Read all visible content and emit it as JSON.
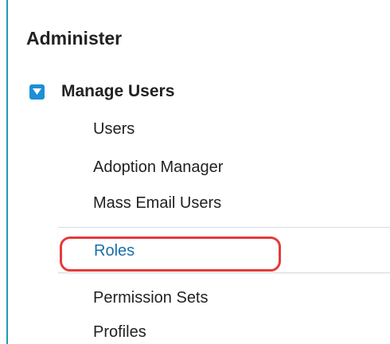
{
  "section": {
    "title": "Administer"
  },
  "group": {
    "label": "Manage Users",
    "icon": "expanded-toggle-icon",
    "icon_color": "#1e8fd6"
  },
  "items": [
    {
      "label": "Users"
    },
    {
      "label": "Adoption Manager"
    },
    {
      "label": "Mass Email Users"
    },
    {
      "label": "Roles",
      "selected": true
    },
    {
      "label": "Permission Sets"
    },
    {
      "label": "Profiles"
    }
  ],
  "colors": {
    "accent_border": "#1f9bb5",
    "selected_text": "#1b6fa8",
    "highlight_ring": "#e53a3a"
  }
}
